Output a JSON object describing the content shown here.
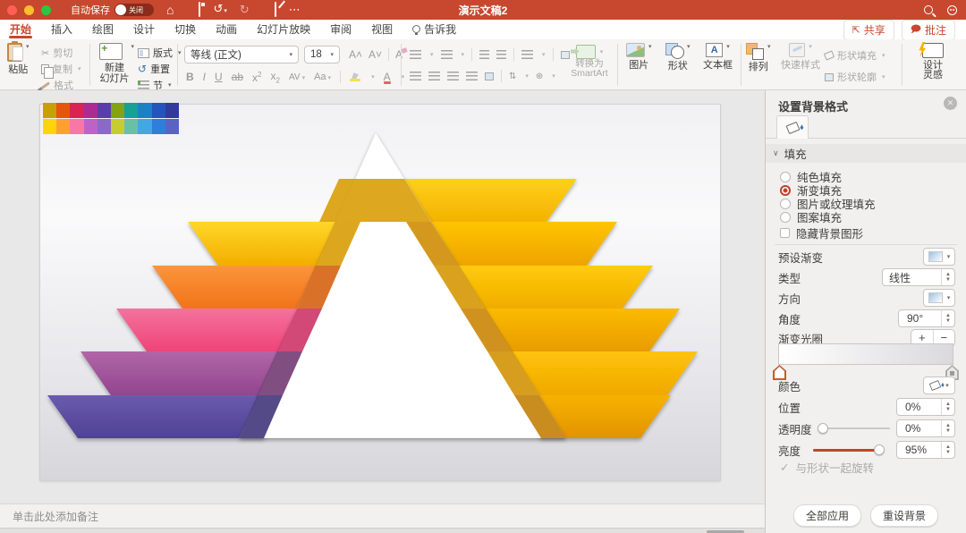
{
  "titlebar": {
    "title": "演示文稿2",
    "autosave_label": "自动保存",
    "autosave_state": "关闭",
    "bg_color": "#C8472F"
  },
  "icons": {
    "caret": "▾",
    "chevron_down": "∨",
    "check": "✓",
    "close": "✕",
    "home": "⌂",
    "undo": "↺",
    "redo": "↻",
    "more": "⋯",
    "scissors": "✂",
    "spin_up": "▲",
    "spin_down": "▼",
    "reset_arrow": "↺"
  },
  "tabs": {
    "items": [
      "开始",
      "插入",
      "绘图",
      "设计",
      "切换",
      "动画",
      "幻灯片放映",
      "审阅",
      "视图",
      "告诉我"
    ],
    "active": "开始",
    "share": "共享",
    "comments": "批注"
  },
  "ribbon": {
    "paste": "粘贴",
    "cut": "剪切",
    "copy": "复制",
    "format_painter": "格式",
    "new_slide_line1": "新建",
    "new_slide_line2": "幻灯片",
    "layout": "版式",
    "reset": "重置",
    "section": "节",
    "font_name": "等线 (正文)",
    "font_size": "18",
    "bold": "B",
    "italic": "I",
    "underline": "U",
    "strikethrough": "ab",
    "superscript": "x",
    "subscript": "x",
    "spacing": "AV",
    "case": "Aa",
    "clear_format": "A",
    "font_color": "A",
    "smartart_line1": "转换为",
    "smartart_line2": "SmartArt",
    "picture": "图片",
    "shapes": "形状",
    "textbox": "文本框",
    "arrange": "排列",
    "quick_styles": "快速样式",
    "shape_fill": "形状填充",
    "shape_outline": "形状轮廓",
    "design_line1": "设计",
    "design_line2": "灵感"
  },
  "panel": {
    "title": "设置背景格式",
    "section_fill": "填充",
    "fill_options": [
      {
        "label": "纯色填充",
        "selected": false
      },
      {
        "label": "渐变填充",
        "selected": true
      },
      {
        "label": "图片或纹理填充",
        "selected": false
      },
      {
        "label": "图案填充",
        "selected": false
      }
    ],
    "hide_bg": "隐藏背景图形",
    "preset_label": "预设渐变",
    "type_label": "类型",
    "type_value": "线性",
    "direction_label": "方向",
    "angle_label": "角度",
    "angle_value": "90°",
    "stops_label": "渐变光圈",
    "stops_plus": "+",
    "stops_minus": "−",
    "color_label": "颜色",
    "position_label": "位置",
    "position_value": "0%",
    "transparency_label": "透明度",
    "transparency_value": "0%",
    "transparency_knob": "6%",
    "brightness_label": "亮度",
    "brightness_value": "95%",
    "brightness_knob": "93%",
    "brightness_fill": "93%",
    "rotate_label": "与形状一起旋转",
    "apply_all": "全部应用",
    "reset_bg": "重设背景",
    "accent_color": "#C0432C"
  },
  "notes": {
    "placeholder": "单击此处添加备注"
  },
  "slide": {
    "palette_top": [
      "#C7A008",
      "#E4560E",
      "#D92350",
      "#AC2A94",
      "#5A3EA8",
      "#84A312",
      "#17A095",
      "#1B81C7",
      "#2355BC",
      "#323A9B"
    ],
    "palette_bottom": [
      "#FFD40A",
      "#FFA02E",
      "#F877A6",
      "#BD63C6",
      "#8A6AC4",
      "#C5CE2E",
      "#68C1A5",
      "#41A8E4",
      "#2E7EDB",
      "#5A63C3"
    ],
    "pyramid_fill": "#FFFFFF",
    "ribbons": {
      "right": [
        {
          "top": "#FFD019",
          "bottom": "#F3B200",
          "wedge": "#D89B00"
        },
        {
          "top": "#FFC400",
          "bottom": "#EDA400",
          "wedge": "#CE8A00"
        },
        {
          "top": "#FFCB0A",
          "bottom": "#F0AC00",
          "wedge": "#D59400"
        },
        {
          "top": "#FBBB00",
          "bottom": "#E89C00",
          "wedge": "#C98300"
        },
        {
          "top": "#FFC30A",
          "bottom": "#EFA800",
          "wedge": "#D29000"
        },
        {
          "top": "#F7B200",
          "bottom": "#E29300",
          "wedge": "#C07C00"
        }
      ],
      "left": [
        {
          "top": "#FFD628",
          "bottom": "#F3AE00",
          "wedge": "#D89A00"
        },
        {
          "top": "#FB953B",
          "bottom": "#F1731A",
          "wedge": "#D55D0A"
        },
        {
          "top": "#F4729E",
          "bottom": "#EE4478",
          "wedge": "#CC2F63"
        },
        {
          "top": "#B166A8",
          "bottom": "#92458D",
          "wedge": "#6F3570"
        },
        {
          "top": "#6A5BAE",
          "bottom": "#4F4193",
          "wedge": "#3C3178"
        }
      ]
    }
  }
}
